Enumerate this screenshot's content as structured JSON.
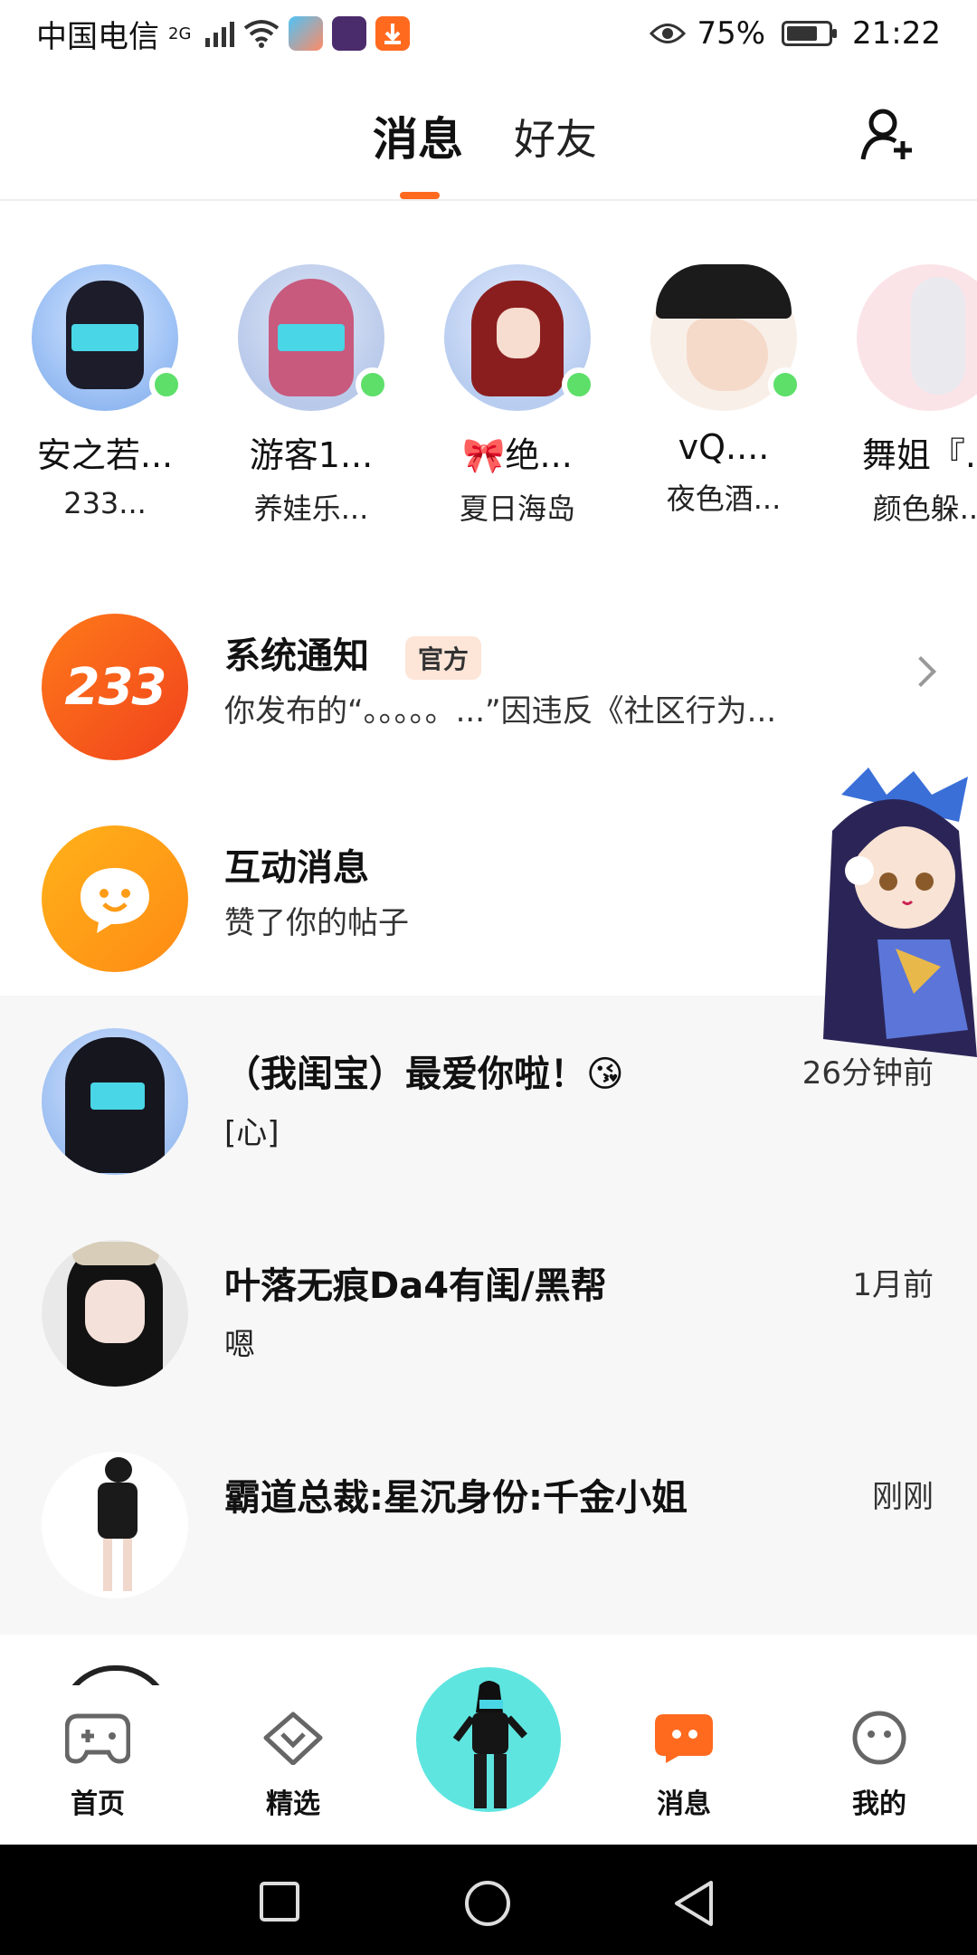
{
  "status_bar": {
    "carrier": "中国电信",
    "network": "2G",
    "battery_percent": "75%",
    "battery_level": 0.75,
    "time": "21:22"
  },
  "header": {
    "tabs": [
      "消息",
      "好友"
    ],
    "active_tab": "消息",
    "accent_color": "#ff6a1f"
  },
  "online_friends": [
    {
      "name": "安之若...",
      "game": "233..."
    },
    {
      "name": "游客1...",
      "game": "养娃乐..."
    },
    {
      "name": "🎀绝...",
      "game": "夏日海岛"
    },
    {
      "name": "vQ....",
      "game": "夜色酒..."
    },
    {
      "name": "舞姐『...",
      "game": "颜色躲..."
    }
  ],
  "system_items": [
    {
      "icon_text": "233",
      "title": "系统通知",
      "badge": "官方",
      "subtitle": "你发布的“。。。。。...”因违反《社区行为..."
    },
    {
      "title": "互动消息",
      "subtitle": "赞了你的帖子"
    }
  ],
  "chats": [
    {
      "name": "（我闺宝）最爱你啦！😘",
      "message": "[心]",
      "time": "26分钟前"
    },
    {
      "name": "叶落无痕Da4有闺/黑帮",
      "message": "嗯",
      "time": "1月前"
    },
    {
      "name": "霸道总裁:星沉身份:千金小姐",
      "message": "",
      "time": "刚刚"
    }
  ],
  "bottom_nav": [
    {
      "label": "首页",
      "icon": "gamepad-icon"
    },
    {
      "label": "精选",
      "icon": "heart-chat-icon"
    },
    {
      "label": "消息",
      "icon": "message-icon",
      "active": true
    },
    {
      "label": "我的",
      "icon": "face-icon"
    }
  ]
}
